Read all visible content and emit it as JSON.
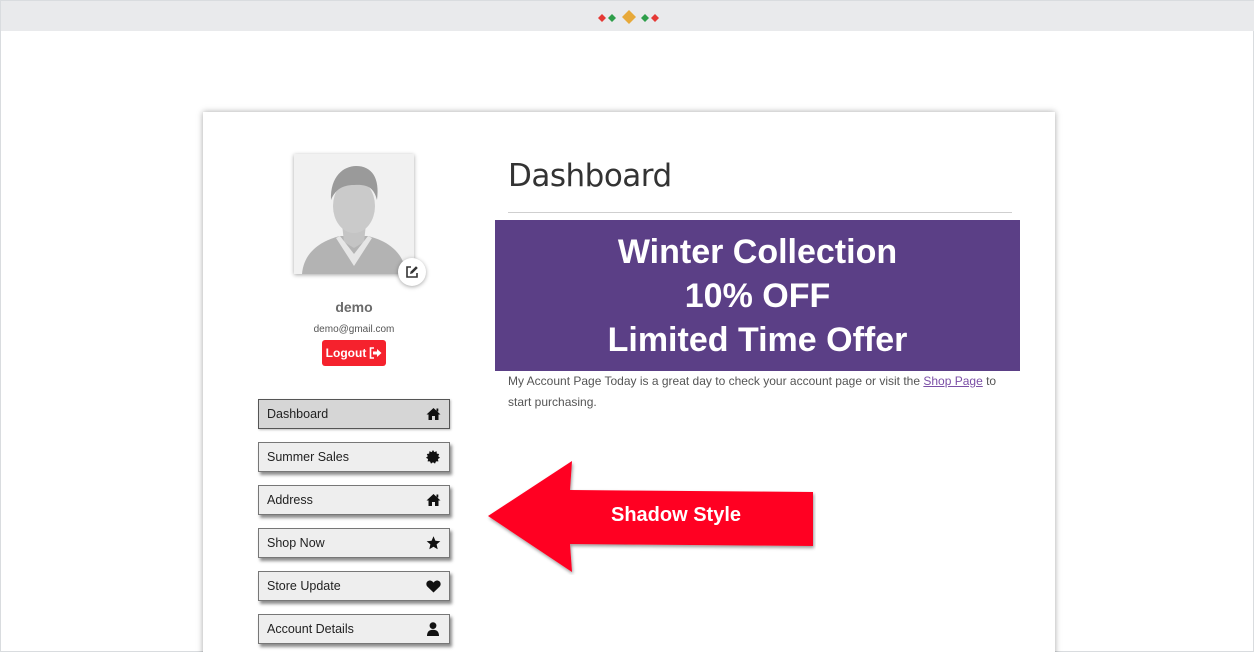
{
  "colors": {
    "top_bar": "#e9eaec",
    "banner_bg": "#5b3f86",
    "logout_bg": "#f5222d",
    "callout_arrow": "#ff0022",
    "link": "#7b4fa6",
    "logo_red": "#e53935",
    "logo_green": "#2e9e4a",
    "logo_gold": "#e7a93a"
  },
  "profile": {
    "username": "demo",
    "email": "demo@gmail.com",
    "logout_label": "Logout",
    "edit_icon": "edit-square-icon",
    "avatar_icon": "user-silhouette-icon"
  },
  "menu": {
    "items": [
      {
        "label": "Dashboard",
        "icon": "home-icon",
        "active": true
      },
      {
        "label": "Summer Sales",
        "icon": "badge-icon",
        "active": false
      },
      {
        "label": "Address",
        "icon": "home-icon",
        "active": false
      },
      {
        "label": "Shop Now",
        "icon": "star-icon",
        "active": false
      },
      {
        "label": "Store Update",
        "icon": "heart-icon",
        "active": false
      },
      {
        "label": "Account Details",
        "icon": "user-icon",
        "active": false
      }
    ]
  },
  "main": {
    "title": "Dashboard",
    "banner": {
      "line1": "Winter Collection",
      "line2": "10% OFF",
      "line3": "Limited Time Offer"
    },
    "intro_before": "My Account Page Today is a great day to check your account page or visit the ",
    "intro_link": "Shop Page",
    "intro_after": " to start purchasing."
  },
  "callout": {
    "label": "Shadow Style"
  }
}
